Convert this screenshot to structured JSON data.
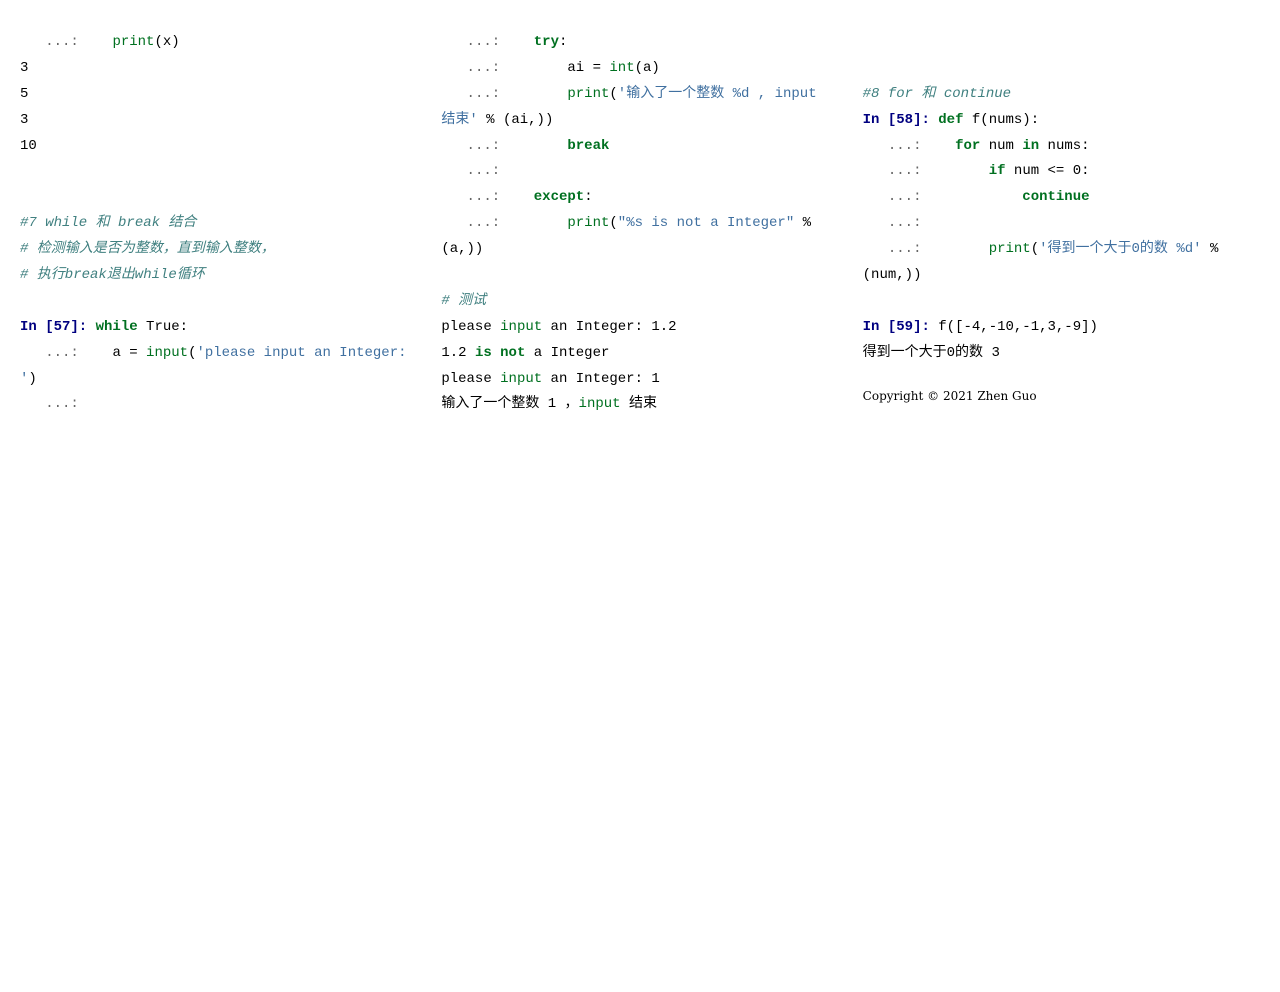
{
  "col1": {
    "lines": [
      {
        "segments": [
          {
            "t": "   ...:    ",
            "c": "p"
          },
          {
            "t": "print",
            "c": "nb"
          },
          {
            "t": "(x)",
            "c": ""
          }
        ]
      },
      {
        "segments": [
          {
            "t": "3",
            "c": ""
          }
        ]
      },
      {
        "segments": [
          {
            "t": "5",
            "c": ""
          }
        ]
      },
      {
        "segments": [
          {
            "t": "3",
            "c": ""
          }
        ]
      },
      {
        "segments": [
          {
            "t": "10",
            "c": ""
          }
        ]
      },
      {
        "segments": [
          {
            "t": " ",
            "c": ""
          }
        ]
      },
      {
        "segments": [
          {
            "t": " ",
            "c": ""
          }
        ]
      },
      {
        "segments": [
          {
            "t": "#7 while 和 break 结合",
            "c": "c"
          }
        ]
      },
      {
        "segments": [
          {
            "t": "# 检测输入是否为整数，直到输入整数，",
            "c": "c"
          }
        ]
      },
      {
        "segments": [
          {
            "t": "# 执行break退出while循环",
            "c": "c"
          }
        ]
      },
      {
        "segments": [
          {
            "t": " ",
            "c": ""
          }
        ]
      },
      {
        "segments": [
          {
            "t": "In [57]: ",
            "c": "nn-in"
          },
          {
            "t": "while",
            "c": "k"
          },
          {
            "t": " True:",
            "c": ""
          }
        ]
      },
      {
        "segments": [
          {
            "t": "   ...:    ",
            "c": "p"
          },
          {
            "t": "a = ",
            "c": ""
          },
          {
            "t": "input",
            "c": "nb"
          },
          {
            "t": "(",
            "c": ""
          },
          {
            "t": "'please input an Integer: '",
            "c": "s"
          },
          {
            "t": ")",
            "c": ""
          }
        ]
      },
      {
        "segments": [
          {
            "t": "   ...:    ",
            "c": "p"
          }
        ]
      }
    ]
  },
  "col2": {
    "lines": [
      {
        "segments": [
          {
            "t": "   ...:    ",
            "c": "p"
          },
          {
            "t": "try",
            "c": "k"
          },
          {
            "t": ":",
            "c": ""
          }
        ]
      },
      {
        "segments": [
          {
            "t": "   ...:        ",
            "c": "p"
          },
          {
            "t": "ai = ",
            "c": ""
          },
          {
            "t": "int",
            "c": "nb"
          },
          {
            "t": "(a)",
            "c": ""
          }
        ]
      },
      {
        "segments": [
          {
            "t": "   ...:        ",
            "c": "p"
          },
          {
            "t": "print",
            "c": "nb"
          },
          {
            "t": "(",
            "c": ""
          },
          {
            "t": "'输入了一个整数 %d , input 结束'",
            "c": "s"
          },
          {
            "t": " % (ai,))",
            "c": ""
          }
        ]
      },
      {
        "segments": [
          {
            "t": "   ...:        ",
            "c": "p"
          },
          {
            "t": "break",
            "c": "k"
          }
        ]
      },
      {
        "segments": [
          {
            "t": "   ...:",
            "c": "p"
          }
        ]
      },
      {
        "segments": [
          {
            "t": "   ...:    ",
            "c": "p"
          },
          {
            "t": "except",
            "c": "k"
          },
          {
            "t": ":",
            "c": ""
          }
        ]
      },
      {
        "segments": [
          {
            "t": "   ...:        ",
            "c": "p"
          },
          {
            "t": "print",
            "c": "nb"
          },
          {
            "t": "(",
            "c": ""
          },
          {
            "t": "\"%s is not a Integer\"",
            "c": "s"
          },
          {
            "t": " % (a,))",
            "c": ""
          }
        ]
      },
      {
        "segments": [
          {
            "t": " ",
            "c": ""
          }
        ]
      },
      {
        "segments": [
          {
            "t": "# 测试",
            "c": "c"
          }
        ]
      },
      {
        "segments": [
          {
            "t": "please ",
            "c": ""
          },
          {
            "t": "input",
            "c": "nb"
          },
          {
            "t": " an Integer: 1.2",
            "c": ""
          }
        ]
      },
      {
        "segments": [
          {
            "t": "1.2 ",
            "c": ""
          },
          {
            "t": "is",
            "c": "k"
          },
          {
            "t": " ",
            "c": ""
          },
          {
            "t": "not",
            "c": "k"
          },
          {
            "t": " a Integer",
            "c": ""
          }
        ]
      },
      {
        "segments": [
          {
            "t": "please ",
            "c": ""
          },
          {
            "t": "input",
            "c": "nb"
          },
          {
            "t": " an Integer: 1",
            "c": ""
          }
        ]
      },
      {
        "segments": [
          {
            "t": "输入了一个整数 1 ，",
            "c": ""
          },
          {
            "t": "input",
            "c": "nb"
          },
          {
            "t": " 结束",
            "c": ""
          }
        ]
      }
    ]
  },
  "col3": {
    "lines": [
      {
        "segments": [
          {
            "t": " ",
            "c": ""
          }
        ]
      },
      {
        "segments": [
          {
            "t": " ",
            "c": ""
          }
        ]
      },
      {
        "segments": [
          {
            "t": "#8 for 和 continue",
            "c": "c"
          }
        ]
      },
      {
        "segments": [
          {
            "t": "In [58]: ",
            "c": "nn-in"
          },
          {
            "t": "def",
            "c": "k"
          },
          {
            "t": " f(nums):",
            "c": ""
          }
        ]
      },
      {
        "segments": [
          {
            "t": "   ...:    ",
            "c": "p"
          },
          {
            "t": "for",
            "c": "k"
          },
          {
            "t": " num ",
            "c": ""
          },
          {
            "t": "in",
            "c": "k"
          },
          {
            "t": " nums:",
            "c": ""
          }
        ]
      },
      {
        "segments": [
          {
            "t": "   ...:        ",
            "c": "p"
          },
          {
            "t": "if",
            "c": "k"
          },
          {
            "t": " num <= 0:",
            "c": ""
          }
        ]
      },
      {
        "segments": [
          {
            "t": "   ...:            ",
            "c": "p"
          },
          {
            "t": "continue",
            "c": "k"
          }
        ]
      },
      {
        "segments": [
          {
            "t": "   ...:",
            "c": "p"
          }
        ]
      },
      {
        "segments": [
          {
            "t": "   ...:        ",
            "c": "p"
          },
          {
            "t": "print",
            "c": "nb"
          },
          {
            "t": "(",
            "c": ""
          },
          {
            "t": "'得到一个大于0的数 %d'",
            "c": "s"
          },
          {
            "t": " % (num,))",
            "c": ""
          }
        ]
      },
      {
        "segments": [
          {
            "t": " ",
            "c": ""
          }
        ]
      },
      {
        "segments": [
          {
            "t": "In [59]: ",
            "c": "nn-in"
          },
          {
            "t": "f([-4,-10,-1,3,-9])",
            "c": ""
          }
        ]
      },
      {
        "segments": [
          {
            "t": "得到一个大于0的数 3",
            "c": ""
          }
        ]
      }
    ],
    "copyright": "Copyright © 2021 Zhen Guo"
  }
}
